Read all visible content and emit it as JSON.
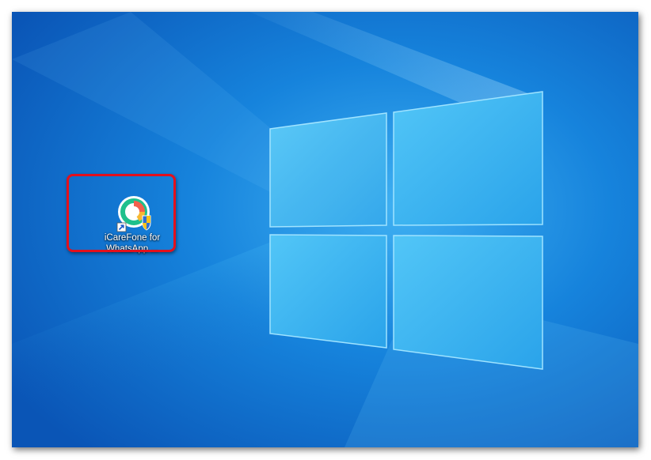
{
  "desktop": {
    "icons": [
      {
        "label_line1": "iCareFone for",
        "label_line2": "WhatsApp ...",
        "icon": "icarefone-whatsapp-app-icon",
        "overlay_icon": "shortcut-arrow-icon",
        "badge_icon": "uac-shield-icon"
      }
    ]
  },
  "colors": {
    "wallpaper_base": "#0a6fd0",
    "highlight": "#e3101c"
  }
}
